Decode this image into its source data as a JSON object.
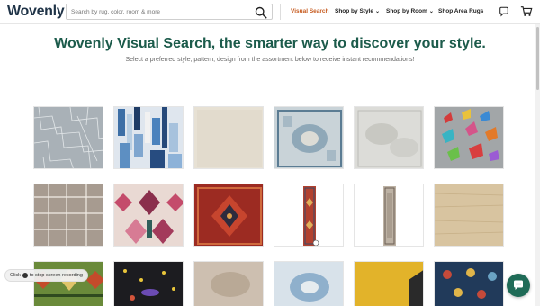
{
  "header": {
    "logo": "Wovenly",
    "search_placeholder": "Search by rug, color, room & more",
    "nav": [
      {
        "label": "Visual Search",
        "active": true
      },
      {
        "label": "Shop by Style",
        "dropdown": true
      },
      {
        "label": "Shop by Room",
        "dropdown": true
      },
      {
        "label": "Shop Area Rugs"
      }
    ],
    "icons": [
      "search-icon",
      "chat-icon",
      "cart-icon"
    ]
  },
  "hero": {
    "title": "Wovenly Visual Search, the smarter way to discover your style.",
    "subtitle": "Select a preferred style, pattern, design from the assortment below to receive instant recommendations!"
  },
  "rugs": [
    "geometric-lines-gray",
    "abstract-blue-patchwork",
    "solid-cream",
    "distressed-blue-vintage",
    "light-gray-abstract",
    "butterflies-kids",
    "taupe-grid",
    "pink-ikat",
    "red-persian-medallion",
    "red-runner",
    "beige-runner",
    "natural-jute",
    "green-kilim",
    "black-space-kids",
    "beige-distressed",
    "light-blue-medallion",
    "yellow-trim",
    "navy-floral"
  ],
  "toast": {
    "prefix": "Click",
    "suffix": "to stop screen recording"
  },
  "colors": {
    "brand": "#1f3347",
    "accent": "#c65a1e",
    "title": "#1c5b4b",
    "chat": "#1f6b57"
  }
}
